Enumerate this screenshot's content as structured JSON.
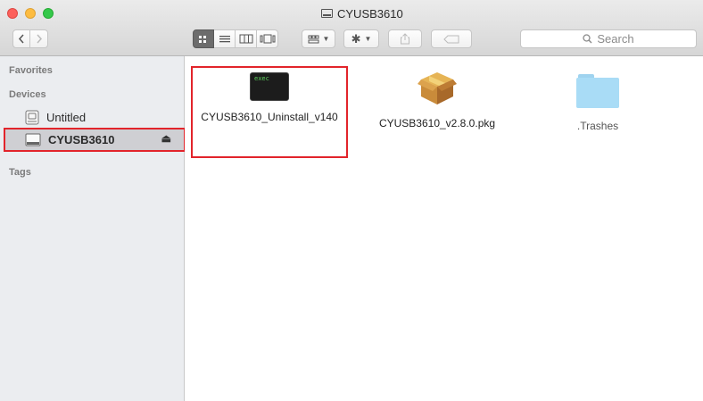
{
  "window": {
    "title": "CYUSB3610"
  },
  "toolbar": {
    "back_icon": "chevron-left-icon",
    "forward_icon": "chevron-right-icon",
    "view_modes": [
      "icon-view",
      "list-view",
      "column-view",
      "cover-flow-view"
    ],
    "search_placeholder": "Search"
  },
  "sidebar": {
    "favorites_label": "Favorites",
    "devices_label": "Devices",
    "tags_label": "Tags",
    "devices": [
      {
        "label": "Untitled",
        "icon": "internal-disk-icon",
        "selected": false
      },
      {
        "label": "CYUSB3610",
        "icon": "external-disk-icon",
        "selected": true,
        "ejectable": true
      }
    ]
  },
  "files": [
    {
      "name": "CYUSB3610_Uninstall_v140",
      "icon": "exec-icon",
      "icon_text": "exec",
      "highlighted": true
    },
    {
      "name": "CYUSB3610_v2.8.0.pkg",
      "icon": "package-icon",
      "highlighted": false
    },
    {
      "name": ".Trashes",
      "icon": "folder-icon",
      "dimmed": true
    }
  ],
  "colors": {
    "highlight_red": "#e2242b",
    "selected_sidebar": "#cfcfd3"
  }
}
